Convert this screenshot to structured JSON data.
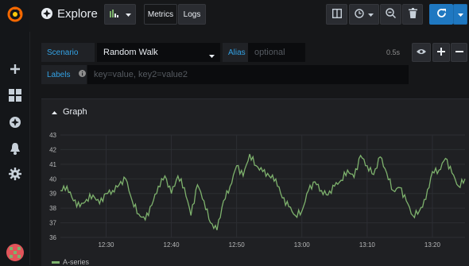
{
  "header": {
    "title": "Explore",
    "tabs": [
      {
        "label": "Metrics"
      },
      {
        "label": "Logs"
      }
    ]
  },
  "query": {
    "scenario_label": "Scenario",
    "scenario_value": "Random Walk",
    "alias_label": "Alias",
    "alias_placeholder": "optional",
    "time_text": "0.5s",
    "labels_label": "Labels",
    "labels_placeholder": "key=value, key2=value2"
  },
  "graph": {
    "title": "Graph"
  },
  "colors": {
    "series": "#7eb26d",
    "accent_blue": "#1f78c1",
    "label_blue": "#33a2e5",
    "logo_orange": "#f46800"
  },
  "icons": [
    "grafana-logo-icon",
    "compass-icon",
    "panel-icon",
    "split-icon",
    "clock-icon",
    "zoom-out-icon",
    "trash-icon",
    "refresh-icon",
    "plus-icon",
    "dashboards-icon",
    "explore-icon",
    "bell-icon",
    "gear-icon",
    "eye-icon",
    "minus-icon",
    "info-icon",
    "caret-icon",
    "avatar"
  ],
  "chart_data": {
    "type": "line",
    "title": "",
    "xlabel": "",
    "ylabel": "",
    "ylim": [
      36,
      43
    ],
    "xlim": [
      "12:23",
      "13:25"
    ],
    "x_ticks": [
      "12:30",
      "12:40",
      "12:50",
      "13:00",
      "13:10",
      "13:20"
    ],
    "y_ticks": [
      36,
      37,
      38,
      39,
      40,
      41,
      42,
      43
    ],
    "grid": true,
    "legend": "bottom-left",
    "series": [
      {
        "name": "A-series",
        "color": "#7eb26d",
        "x": [
          "12:23",
          "12:24",
          "12:25",
          "12:26",
          "12:27",
          "12:28",
          "12:29",
          "12:30",
          "12:31",
          "12:32",
          "12:33",
          "12:34",
          "12:35",
          "12:36",
          "12:37",
          "12:38",
          "12:39",
          "12:40",
          "12:41",
          "12:42",
          "12:43",
          "12:44",
          "12:45",
          "12:46",
          "12:47",
          "12:48",
          "12:49",
          "12:50",
          "12:51",
          "12:52",
          "12:53",
          "12:54",
          "12:55",
          "12:56",
          "12:57",
          "12:58",
          "12:59",
          "13:00",
          "13:01",
          "13:02",
          "13:03",
          "13:04",
          "13:05",
          "13:06",
          "13:07",
          "13:08",
          "13:09",
          "13:10",
          "13:11",
          "13:12",
          "13:13",
          "13:14",
          "13:15",
          "13:16",
          "13:17",
          "13:18",
          "13:19",
          "13:20",
          "13:21",
          "13:22",
          "13:23",
          "13:24",
          "13:25"
        ],
        "values": [
          39.2,
          39.5,
          38.5,
          38.1,
          38.6,
          38.9,
          38.3,
          39.0,
          39.2,
          39.6,
          40.0,
          38.5,
          37.6,
          37.2,
          38.2,
          39.5,
          40.2,
          39.0,
          40.2,
          39.4,
          37.5,
          39.6,
          38.5,
          37.0,
          36.5,
          38.5,
          39.5,
          40.9,
          40.2,
          41.7,
          40.9,
          40.5,
          40.2,
          40.0,
          38.7,
          38.1,
          37.5,
          37.8,
          39.2,
          39.8,
          39.2,
          38.9,
          39.5,
          39.9,
          40.6,
          40.1,
          41.6,
          40.9,
          40.3,
          41.5,
          40.4,
          39.2,
          39.4,
          38.5,
          37.5,
          37.8,
          38.6,
          40.5,
          40.6,
          41.4,
          40.4,
          39.5,
          40.0
        ]
      }
    ]
  }
}
